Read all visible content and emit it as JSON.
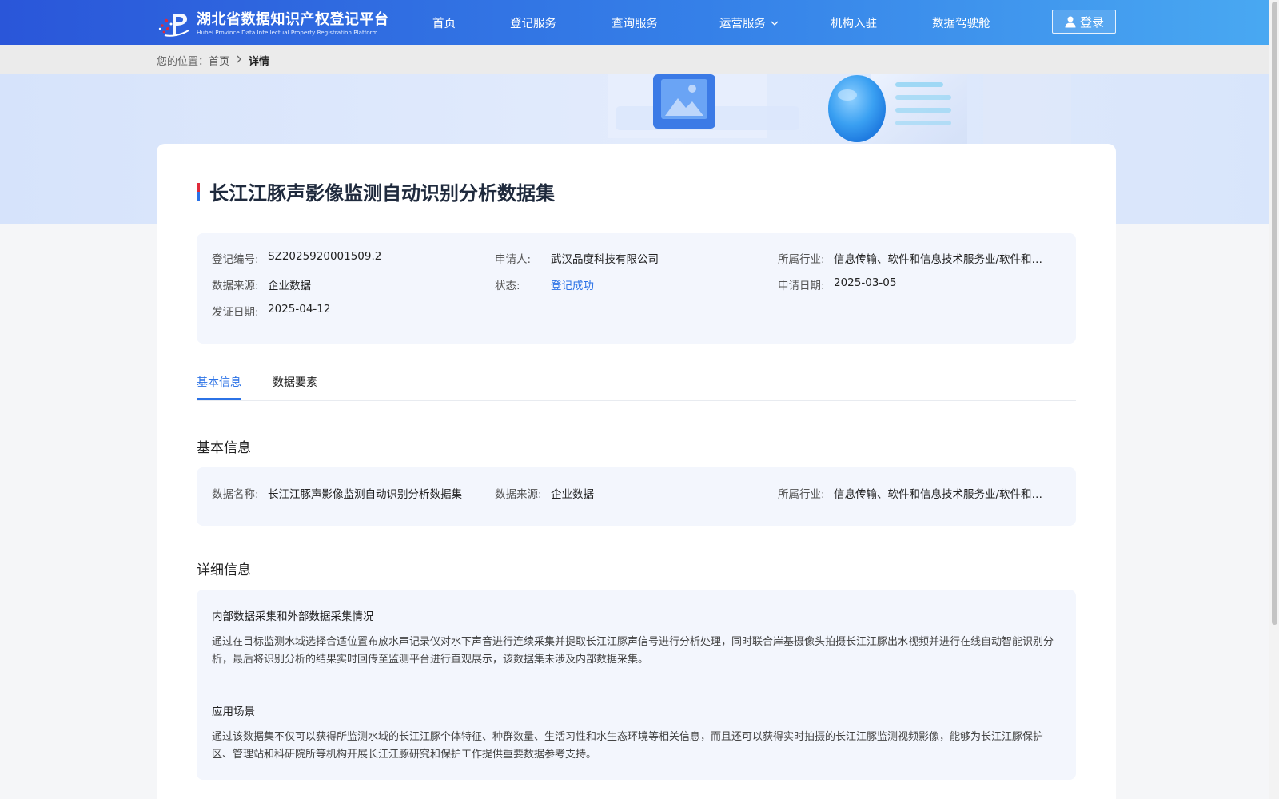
{
  "header": {
    "logo_cn": "湖北省数据知识产权登记平台",
    "logo_en": "Hubei Province Data Intellectual Property Registration Platform",
    "nav": [
      {
        "label": "首页"
      },
      {
        "label": "登记服务"
      },
      {
        "label": "查询服务"
      },
      {
        "label": "运营服务",
        "has_dropdown": true
      },
      {
        "label": "机构入驻"
      },
      {
        "label": "数据驾驶舱"
      }
    ],
    "login_label": "登录",
    "login_icon": "user-icon",
    "dropdown_icon": "chevron-down-icon"
  },
  "breadcrumb": {
    "prefix": "您的位置：",
    "home": "首页",
    "separator_icon": "chevron-right-icon",
    "current": "详情"
  },
  "detail": {
    "title": "长江江豚声影像监测自动识别分析数据集",
    "summary": {
      "reg_no_label": "登记编号:",
      "reg_no": "SZ2025920001509.2",
      "applicant_label": "申请人:",
      "applicant": "武汉品度科技有限公司",
      "industry_label": "所属行业:",
      "industry": "信息传输、软件和信息技术服务业/软件和…",
      "source_label": "数据来源:",
      "source": "企业数据",
      "status_label": "状态:",
      "status": "登记成功",
      "apply_date_label": "申请日期:",
      "apply_date": "2025-03-05",
      "issue_date_label": "发证日期:",
      "issue_date": "2025-04-12"
    },
    "tabs": [
      {
        "label": "基本信息",
        "active": true
      },
      {
        "label": "数据要素",
        "active": false
      }
    ],
    "basic_section_title": "基本信息",
    "basic": {
      "name_label": "数据名称:",
      "name": "长江江豚声影像监测自动识别分析数据集",
      "source_label": "数据来源:",
      "source": "企业数据",
      "industry_label": "所属行业:",
      "industry": "信息传输、软件和信息技术服务业/软件和…"
    },
    "detail_section_title": "详细信息",
    "detail_items": [
      {
        "heading": "内部数据采集和外部数据采集情况",
        "text": "通过在目标监测水域选择合适位置布放水声记录仪对水下声音进行连续采集并提取长江江豚声信号进行分析处理，同时联合岸基摄像头拍摄长江江豚出水视频并进行在线自动智能识别分析，最后将识别分析的结果实时回传至监测平台进行直观展示，该数据集未涉及内部数据采集。"
      },
      {
        "heading": "应用场景",
        "text": "通过该数据集不仅可以获得所监测水域的长江江豚个体特征、种群数量、生活习性和水生态环境等相关信息，而且还可以获得实时拍摄的长江江豚监测视频影像，能够为长江江豚保护区、管理站和科研院所等机构开展长江江豚研究和保护工作提供重要数据参考支持。"
      }
    ]
  },
  "colors": {
    "header_start": "#2a56d9",
    "header_end": "#49a9f2",
    "accent": "#2b72e6",
    "panel_bg": "#f3f6fd"
  }
}
